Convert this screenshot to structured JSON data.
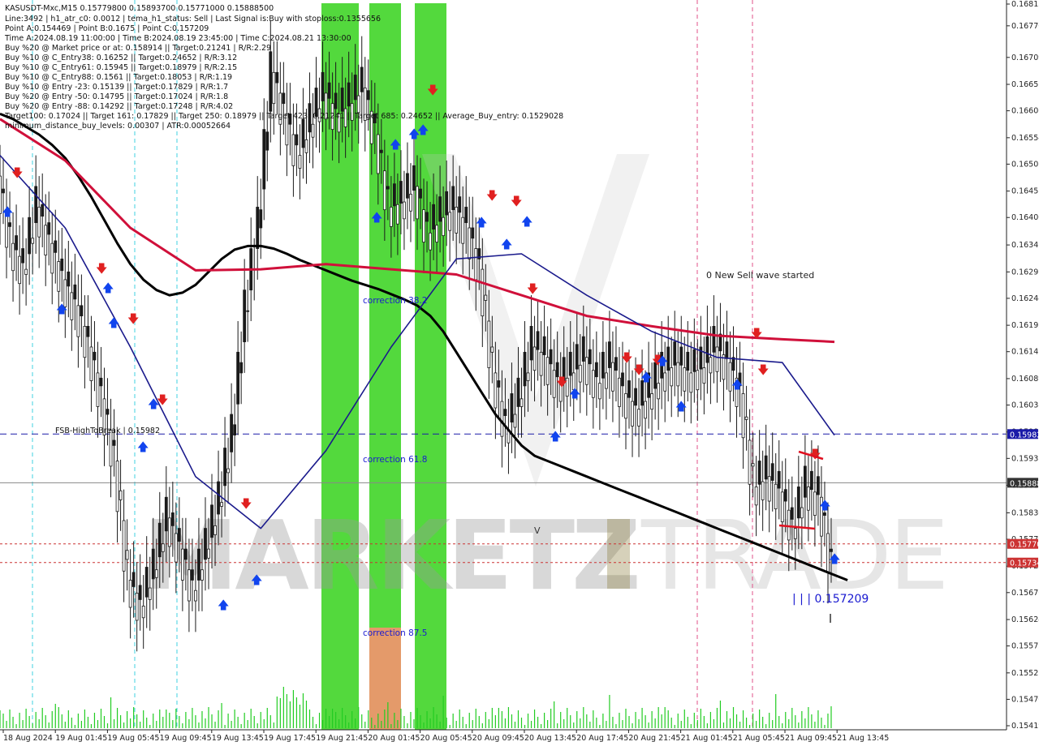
{
  "chart_data": {
    "type": "line",
    "symbol": "KASUSDT-Mxc,M15",
    "ohlc_header": "KASUSDT-Mxc,M15  0.15779800 0.15893700 0.15771000 0.15888500",
    "info_lines": [
      "Line:3492 | h1_atr_c0: 0.0012 | tema_h1_status: Sell | Last Signal is:Buy with stoploss:0.1355656",
      "Point A:0.154469 | Point B:0.1675 | Point C:0.157209",
      "Time A:2024.08.19 11:00:00 | Time B:2024.08.19 23:45:00 | Time C:2024.08.21 13:30:00",
      "Buy %20 @ Market price or at: 0.158914 || Target:0.21241 | R/R:2.29",
      "Buy %10 @ C_Entry38: 0.16252 || Target:0.24652 | R/R:3.12",
      "Buy %10 @ C_Entry61: 0.15945 || Target:0.18979 | R/R:2.15",
      "Buy %10 @ C_Entry88: 0.1561 || Target:0.18053 | R/R:1.19",
      "Buy %10 @ Entry -23: 0.15139 || Target:0.17829 | R/R:1.7",
      "Buy %20 @ Entry -50: 0.14795 || Target:0.17024 | R/R:1.8",
      "Buy %20 @ Entry -88: 0.14292 || Target:0.17248 | R/R:4.02",
      "Target100: 0.17024 || Target 161: 0.17829 || Target 250: 0.18979 || Target 423: 0.21241 || Target 685: 0.24652 || Average_Buy_entry: 0.1529028",
      "minimum_distance_buy_levels: 0.00307 | ATR:0.00052664"
    ],
    "y_ticks": [
      "0.16812",
      "0.16770",
      "0.16709",
      "0.16657",
      "0.16606",
      "0.16554",
      "0.16503",
      "0.16451",
      "0.16400",
      "0.16347",
      "0.16295",
      "0.16244",
      "0.16192",
      "0.16141",
      "0.16089",
      "0.16038",
      "0.15986",
      "0.15935",
      "0.15883",
      "0.15830",
      "0.15779",
      "0.15727",
      "0.15676",
      "0.15624",
      "0.15573",
      "0.15521",
      "0.15470",
      "0.15419"
    ],
    "x_ticks": [
      "18 Aug 2024",
      "19 Aug 01:45",
      "19 Aug 05:45",
      "19 Aug 09:45",
      "19 Aug 13:45",
      "19 Aug 17:45",
      "19 Aug 21:45",
      "20 Aug 01:45",
      "20 Aug 05:45",
      "20 Aug 09:45",
      "20 Aug 13:45",
      "20 Aug 17:45",
      "20 Aug 21:45",
      "21 Aug 01:45",
      "21 Aug 05:45",
      "21 Aug 09:45",
      "21 Aug 13:45"
    ],
    "ylim": [
      0.15419,
      0.16812
    ],
    "price_tags": [
      {
        "label": "0.15982",
        "value": 0.15982,
        "color": "#1a1aa8"
      },
      {
        "label": "0.15888",
        "value": 0.15888,
        "color": "#333333"
      },
      {
        "label": "0.15770",
        "value": 0.1577,
        "color": "#cc3333"
      },
      {
        "label": "0.15734",
        "value": 0.15734,
        "color": "#cc3333"
      }
    ],
    "horizontal_lines": [
      {
        "name": "FSB-HighToBreak",
        "label": "FSB-HighToBreak | 0.15982",
        "value": 0.15982,
        "color": "#1a1aa8",
        "style": "dashed"
      },
      {
        "name": "current",
        "value": 0.15888,
        "color": "#888888",
        "style": "solid"
      },
      {
        "name": "level-a",
        "value": 0.1577,
        "color": "#cc3333",
        "style": "dotted"
      },
      {
        "name": "level-b",
        "value": 0.15734,
        "color": "#cc3333",
        "style": "dotted"
      }
    ],
    "series": [
      {
        "name": "",
        "color": "#000000",
        "x": [
          0,
          4,
          8,
          12,
          16,
          20,
          24,
          28,
          32,
          36,
          40,
          44,
          48,
          52,
          56,
          60,
          64,
          68,
          72,
          76,
          80,
          84,
          88,
          92,
          96,
          100,
          104,
          108,
          112,
          116,
          120,
          124,
          128,
          132,
          136,
          140,
          144,
          148,
          152,
          156,
          160,
          164,
          168,
          172,
          176,
          180,
          184,
          188,
          192,
          196,
          200,
          204,
          208,
          212,
          216,
          220,
          224,
          228,
          232,
          236,
          240,
          244,
          248,
          252,
          256,
          260
        ],
        "y": [
          0.166,
          0.1659,
          0.16575,
          0.1656,
          0.1654,
          0.16515,
          0.1648,
          0.1644,
          0.16395,
          0.1635,
          0.1631,
          0.1628,
          0.1626,
          0.1625,
          0.16255,
          0.1627,
          0.16295,
          0.1632,
          0.16338,
          0.16345,
          0.16345,
          0.1634,
          0.1633,
          0.16318,
          0.16308,
          0.16298,
          0.16288,
          0.16278,
          0.1627,
          0.16262,
          0.16252,
          0.16242,
          0.1623,
          0.1621,
          0.1618,
          0.1614,
          0.161,
          0.1606,
          0.1602,
          0.1599,
          0.1596,
          0.1594,
          0.1593,
          0.1592,
          0.1591,
          0.159,
          0.1589,
          0.1588,
          0.1587,
          0.1586,
          0.1585,
          0.1584,
          0.1583,
          0.1582,
          0.1581,
          0.158,
          0.1579,
          0.1578,
          0.1577,
          0.1576,
          0.1575,
          0.1574,
          0.1573,
          0.1572,
          0.1571,
          0.157
        ]
      },
      {
        "name": "",
        "color": "#d0103a",
        "x": [
          0,
          20,
          40,
          60,
          80,
          100,
          120,
          140,
          160,
          180,
          200,
          220,
          240,
          256
        ],
        "y": [
          0.1659,
          0.1651,
          0.1638,
          0.16298,
          0.163,
          0.1631,
          0.163,
          0.1629,
          0.1625,
          0.1621,
          0.1619,
          0.16172,
          0.16165,
          0.1616
        ]
      },
      {
        "name": "",
        "color": "#1a1a8c",
        "x": [
          0,
          20,
          40,
          60,
          80,
          100,
          120,
          140,
          160,
          180,
          200,
          220,
          240,
          256
        ],
        "y": [
          0.1652,
          0.1638,
          0.1615,
          0.159,
          0.158,
          0.1595,
          0.1615,
          0.1632,
          0.1633,
          0.1625,
          0.1618,
          0.1613,
          0.1612,
          0.1598
        ]
      },
      {
        "name": "",
        "color": "#111111",
        "x": [
          0,
          4,
          8,
          12,
          16,
          20,
          24,
          28,
          32,
          36,
          40,
          44,
          48,
          52,
          56,
          60,
          64,
          68,
          72,
          76,
          80,
          84,
          88,
          92,
          96,
          100,
          104,
          108,
          112,
          116,
          120,
          124,
          128,
          132,
          136,
          140,
          144,
          148,
          152,
          156,
          160,
          164,
          168,
          172,
          176,
          180,
          184,
          188,
          192,
          196,
          200,
          204,
          208,
          212,
          216,
          220,
          224,
          228,
          232,
          236,
          240,
          244,
          248,
          252,
          256
        ],
        "y": [
          0.1648,
          0.1635,
          0.163,
          0.1642,
          0.1635,
          0.1628,
          0.1623,
          0.1615,
          0.1605,
          0.1593,
          0.157,
          0.1565,
          0.1572,
          0.1582,
          0.1576,
          0.1568,
          0.1576,
          0.1585,
          0.1598,
          0.1622,
          0.1638,
          0.1668,
          0.166,
          0.1652,
          0.1658,
          0.1664,
          0.166,
          0.1662,
          0.1665,
          0.1656,
          0.1642,
          0.1643,
          0.1646,
          0.1637,
          0.164,
          0.1642,
          0.1638,
          0.163,
          0.161,
          0.1599,
          0.1605,
          0.1615,
          0.1613,
          0.1608,
          0.161,
          0.1613,
          0.1608,
          0.1612,
          0.1606,
          0.1603,
          0.1606,
          0.161,
          0.1612,
          0.161,
          0.1611,
          0.1615,
          0.1612,
          0.1606,
          0.1588,
          0.159,
          0.1587,
          0.158,
          0.1588,
          0.1586,
          0.1572
        ]
      }
    ],
    "zones": [
      {
        "label": "correction 38.2",
        "value": 0.16244
      },
      {
        "label": "correction 61.8",
        "value": 0.15935
      },
      {
        "label": "correction 87.5",
        "value": 0.15573
      }
    ],
    "annotations": [
      {
        "text": "0 New Sell wave started",
        "value": 0.16295
      },
      {
        "text": "| | | 0.157209",
        "value": 0.15676
      },
      {
        "text": "V",
        "value": 0.1579
      }
    ],
    "watermark": {
      "part1": "MARKETZ",
      "part2": "I",
      "part3": "TRADE"
    }
  }
}
